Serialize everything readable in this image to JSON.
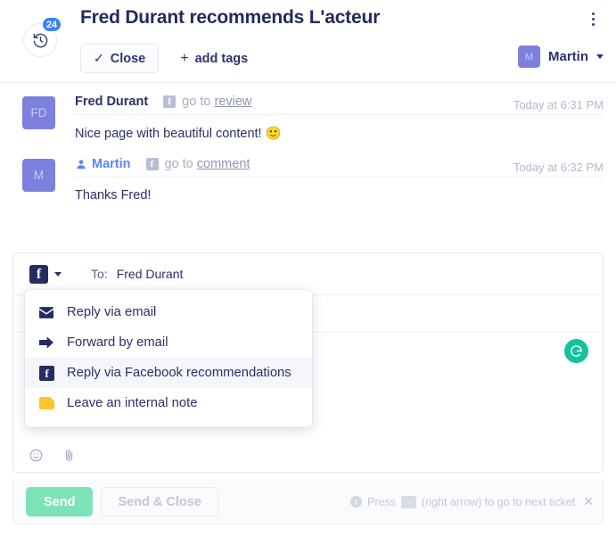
{
  "header": {
    "title": "Fred Durant recommends L'acteur",
    "history_badge": "24",
    "history_icon": "history-clock-icon",
    "kebab_icon": "more-vertical-icon",
    "close_label": "Close",
    "close_check": "✓",
    "add_tags_label": "add tags",
    "add_tags_plus": "+",
    "user": {
      "initial": "M",
      "name": "Martin"
    }
  },
  "messages": [
    {
      "avatar": "FD",
      "author": "Fred Durant",
      "author_is_link": false,
      "channel_icon": "facebook-icon",
      "goto_prefix": "go to",
      "goto_link": "review",
      "time": "Today at 6:31 PM",
      "text": "Nice page with beautiful content! 🙂"
    },
    {
      "avatar": "M",
      "author": "Martin",
      "author_is_link": true,
      "channel_icon": "facebook-icon",
      "goto_prefix": "go to",
      "goto_link": "comment",
      "time": "Today at 6:32 PM",
      "text": "Thanks Fred!"
    }
  ],
  "compose": {
    "channel_icon": "facebook-icon",
    "channel_caret": "chevron-down-icon",
    "to_label": "To:",
    "to_value": "Fred Durant",
    "subject_value": "",
    "body_value": "",
    "grammarly_icon": "grammarly-icon",
    "emoji_icon": "emoji-icon",
    "attachment_icon": "paperclip-icon"
  },
  "dropdown": {
    "items": [
      {
        "label": "Reply via email",
        "icon": "envelope-icon",
        "active": false
      },
      {
        "label": "Forward by email",
        "icon": "arrow-right-icon",
        "active": false
      },
      {
        "label": "Reply via Facebook recommendations",
        "icon": "facebook-icon",
        "active": true
      },
      {
        "label": "Leave an internal note",
        "icon": "note-icon",
        "active": false
      }
    ]
  },
  "footer": {
    "send_label": "Send",
    "send_close_label": "Send & Close",
    "hint_info_icon": "info-icon",
    "hint_press": "Press",
    "hint_key": "→",
    "hint_rest": "(right arrow) to go to next ticket",
    "hint_close": "✕"
  },
  "colors": {
    "accent_navy": "#2b3068",
    "badge_blue": "#3b82f6",
    "avatar_purple": "#7d81dd",
    "send_green": "#7ee2b8",
    "grammarly_green": "#15c39a",
    "link_blue": "#5b86f5",
    "note_yellow": "#ffc42e"
  }
}
